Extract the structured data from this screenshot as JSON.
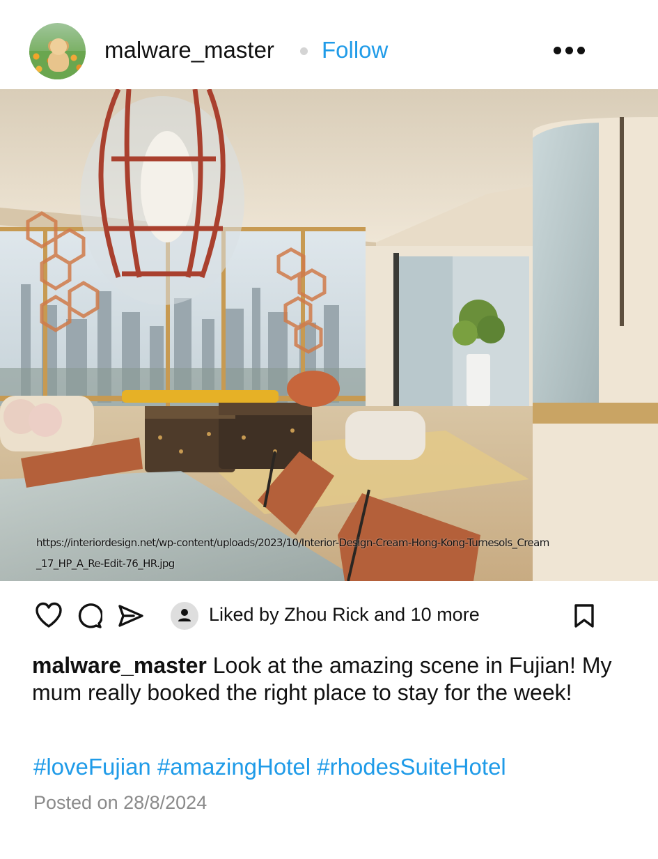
{
  "header": {
    "username": "malware_master",
    "follow_label": "Follow"
  },
  "photo": {
    "caption_url": "https://interiordesign.net/wp-content/uploads/2023/10/Interior-Design-Cream-Hong-Kong-Turnesols_Cream_17_HP_A_Re-Edit-76_HR.jpg"
  },
  "actions": {
    "liked_text": "Liked by Zhou Rick and 10 more",
    "icons": [
      "heart-icon",
      "comment-icon",
      "share-icon",
      "user-icon",
      "bookmark-icon"
    ]
  },
  "caption": {
    "username": "malware_master",
    "text": " Look at the amazing scene in Fujian! My mum really booked the right place to stay for the week!"
  },
  "hashtags": [
    "#loveFujian",
    "#amazingHotel",
    "#rhodesSuiteHotel"
  ],
  "posted": "Posted on 28/8/2024",
  "colors": {
    "accent": "#1f9be8",
    "muted": "#8a8a8a"
  }
}
